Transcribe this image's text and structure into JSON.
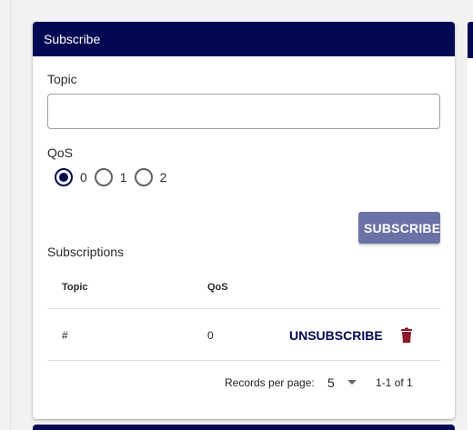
{
  "card": {
    "title": "Subscribe",
    "header_color": "#020952"
  },
  "topic": {
    "label": "Topic",
    "value": "",
    "placeholder": ""
  },
  "qos": {
    "label": "QoS",
    "options": [
      "0",
      "1",
      "2"
    ],
    "selected": "0"
  },
  "subscribe_button": {
    "label": "SUBSCRIBE",
    "color": "#6b72a6"
  },
  "subscriptions": {
    "title": "Subscriptions",
    "columns": [
      "Topic",
      "QoS"
    ],
    "rows": [
      {
        "topic": "#",
        "qos": "0",
        "action_label": "UNSUBSCRIBE",
        "delete_icon": "trash-icon"
      }
    ],
    "pagination": {
      "records_per_page_label": "Records per page:",
      "records_per_page": "5",
      "range": "1-1 of 1"
    }
  },
  "colors": {
    "accent": "#020952",
    "delete": "#8b1a2b"
  }
}
